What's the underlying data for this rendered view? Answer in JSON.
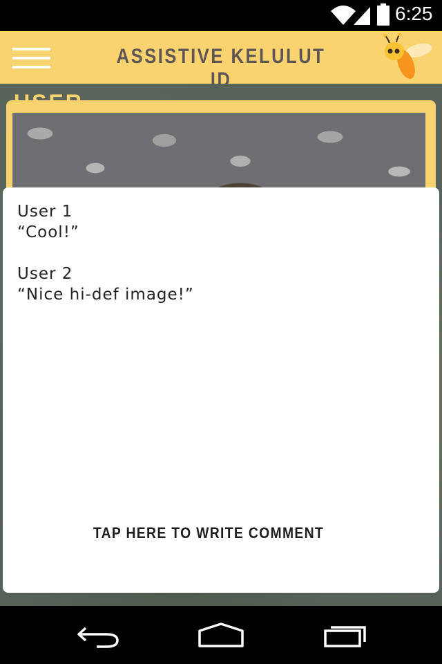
{
  "status_bar": {
    "time": "6:25",
    "icons": [
      "wifi-icon",
      "signal-icon",
      "battery-icon"
    ]
  },
  "app_bar": {
    "title": "ASSISTIVE KELULUT ID",
    "menu_icon": "hamburger-menu-icon",
    "logo_icon": "bee-icon"
  },
  "background": {
    "heading": "USER"
  },
  "comments": [
    {
      "author": "User 1",
      "text": "“Cool!”"
    },
    {
      "author": "User 2",
      "text": "“Nice hi-def image!”"
    }
  ],
  "write_comment_label": "TAP HERE TO WRITE COMMENT",
  "nav_bar": {
    "icons": [
      "back-icon",
      "home-icon",
      "recent-apps-icon"
    ]
  },
  "colors": {
    "accent": "#f9d36f",
    "title_text": "#5e5555",
    "panel": "#ffffff"
  }
}
